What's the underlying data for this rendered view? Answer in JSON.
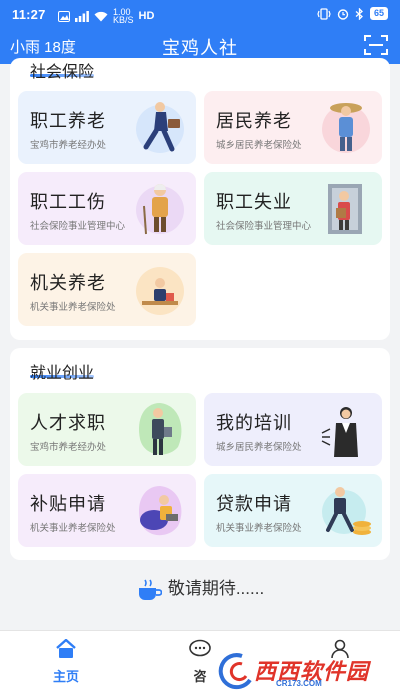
{
  "status_bar": {
    "time": "11:27",
    "net_speed": "1.00",
    "net_unit": "KB/S",
    "hd": "HD",
    "battery": "65"
  },
  "header": {
    "weather": "小雨 18度",
    "title": "宝鸡人社",
    "scan_icon": "scan-icon"
  },
  "social_insurance": {
    "title": "社会保险",
    "tiles": [
      {
        "label": "职工养老",
        "sub": "宝鸡市养老经办处",
        "bg": "#eaf2fd",
        "icon": "running-worker-illustration"
      },
      {
        "label": "居民养老",
        "sub": "城乡居民养老保险处",
        "bg": "#fdeef0",
        "icon": "farmer-illustration"
      },
      {
        "label": "职工工伤",
        "sub": "社会保险事业管理中心",
        "bg": "#f6ecfb",
        "icon": "injured-worker-illustration"
      },
      {
        "label": "职工失业",
        "sub": "社会保险事业管理中心",
        "bg": "#e6f8f2",
        "icon": "leaving-worker-illustration"
      },
      {
        "label": "机关养老",
        "sub": "机关事业养老保险处",
        "bg": "#fdf3e6",
        "icon": "office-worker-illustration"
      }
    ]
  },
  "employment": {
    "title": "就业创业",
    "tiles": [
      {
        "label": "人才求职",
        "sub": "宝鸡市养老经办处",
        "bg": "#ecf9ea",
        "icon": "job-seeker-illustration"
      },
      {
        "label": "我的培训",
        "sub": "城乡居民养老保险处",
        "bg": "#eeeefc",
        "icon": "trainer-illustration"
      },
      {
        "label": "补贴申请",
        "sub": "机关事业养老保险处",
        "bg": "#f6ecfb",
        "icon": "applicant-illustration"
      },
      {
        "label": "贷款申请",
        "sub": "机关事业养老保险处",
        "bg": "#e6f7f9",
        "icon": "loan-illustration"
      }
    ]
  },
  "coming_soon": "敬请期待......",
  "bottom_nav": {
    "home": "主页",
    "consult": "咨",
    "active_color": "#2f7ef6"
  },
  "watermark": {
    "text": "西西软件园",
    "sub": "CR173.COM"
  },
  "colors": {
    "primary": "#2f7ef6"
  }
}
